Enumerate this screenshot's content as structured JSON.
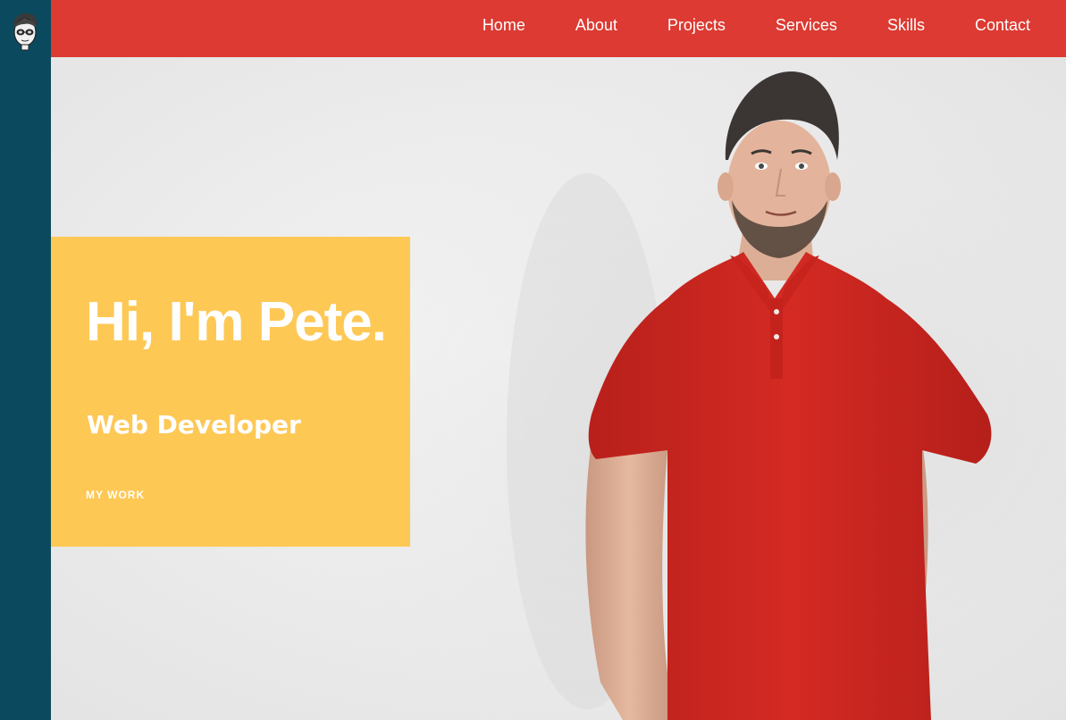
{
  "nav": {
    "items": [
      {
        "label": "Home"
      },
      {
        "label": "About"
      },
      {
        "label": "Projects"
      },
      {
        "label": "Services"
      },
      {
        "label": "Skills"
      },
      {
        "label": "Contact"
      }
    ]
  },
  "intro": {
    "title": "Hi, I'm Pete.",
    "subtitle": "Web Developer",
    "cta_label": "MY WORK"
  },
  "colors": {
    "sidebar": "#0b4a5e",
    "navbar": "#dc3a32",
    "card": "#fec855",
    "shirt": "#d42a23"
  },
  "icons": {
    "logo": "avatar-logo-icon"
  }
}
